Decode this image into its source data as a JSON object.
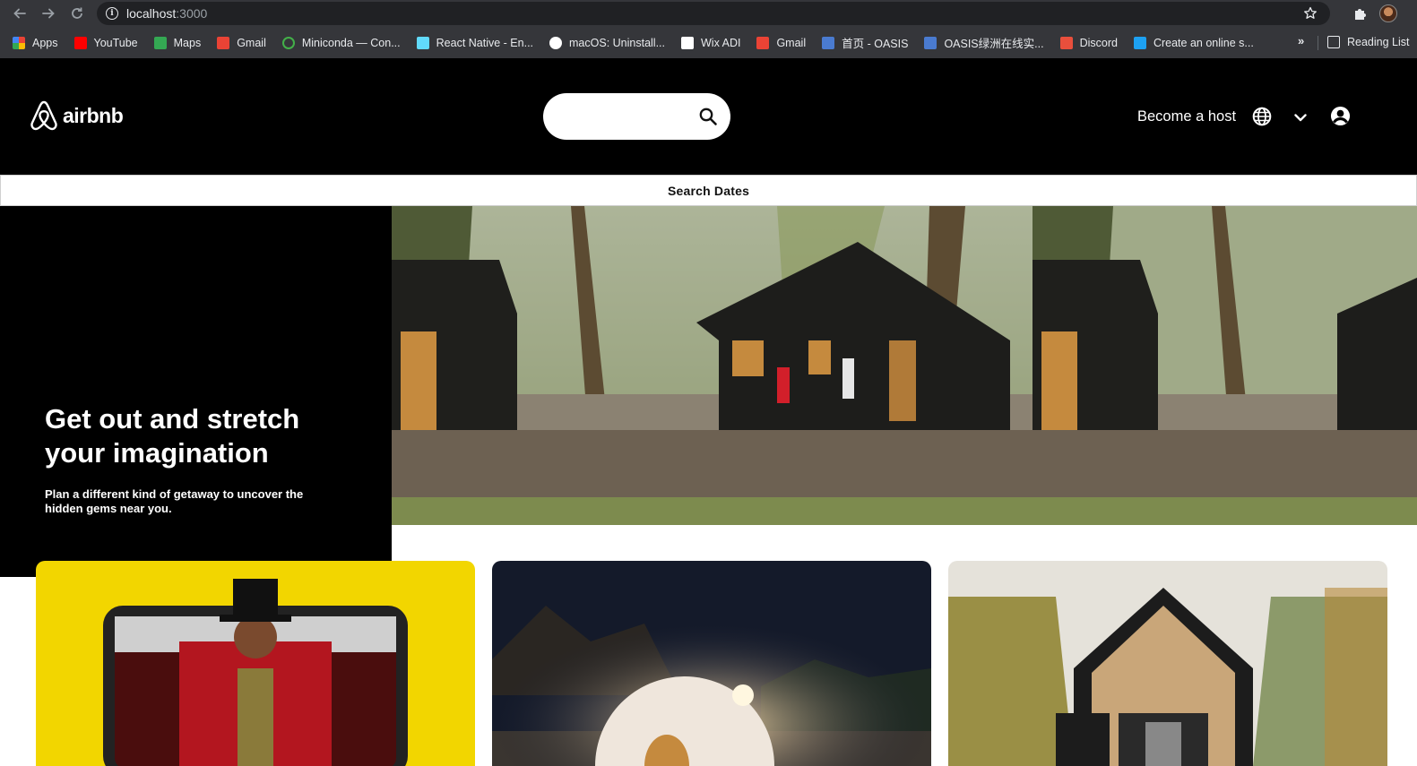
{
  "browser": {
    "url_host": "localhost",
    "url_port": ":3000",
    "bookmarks": [
      {
        "label": "Apps",
        "icon": "apps-grid-icon",
        "color": "#ea4335"
      },
      {
        "label": "YouTube",
        "icon": "youtube-icon",
        "color": "#ff0000"
      },
      {
        "label": "Maps",
        "icon": "maps-icon",
        "color": "#34a853"
      },
      {
        "label": "Gmail",
        "icon": "gmail-icon",
        "color": "#ea4335"
      },
      {
        "label": "Miniconda — Con...",
        "icon": "miniconda-icon",
        "color": "#43b049"
      },
      {
        "label": "React Native - En...",
        "icon": "react-icon",
        "color": "#61dafb"
      },
      {
        "label": "macOS: Uninstall...",
        "icon": "github-icon",
        "color": "#ffffff"
      },
      {
        "label": "Wix ADI",
        "icon": "wix-icon",
        "color": "#ffffff"
      },
      {
        "label": "Gmail",
        "icon": "gmail-icon",
        "color": "#ea4335"
      },
      {
        "label": "首页 - OASIS",
        "icon": "oasis-icon",
        "color": "#4a7bd0"
      },
      {
        "label": "OASIS绿洲在线实...",
        "icon": "oasis-icon",
        "color": "#4a7bd0"
      },
      {
        "label": "Discord",
        "icon": "discord-icon",
        "color": "#e94f3c"
      },
      {
        "label": "Create an online s...",
        "icon": "site-builder-icon",
        "color": "#1da1f2"
      }
    ],
    "more_label": "»",
    "reading_list": "Reading List"
  },
  "header": {
    "brand": "airbnb",
    "brand_color": "#ffffff",
    "search_placeholder": "",
    "host_label": "Become a host"
  },
  "dates_bar": {
    "label": "Search Dates"
  },
  "hero": {
    "title": "Get out and stretch your imagination",
    "subtitle": "Plan a different kind of getaway to uncover the hidden gems near you."
  },
  "cards": [
    {
      "name": "online-experience-card"
    },
    {
      "name": "dome-stay-card"
    },
    {
      "name": "cabin-stay-card"
    }
  ]
}
